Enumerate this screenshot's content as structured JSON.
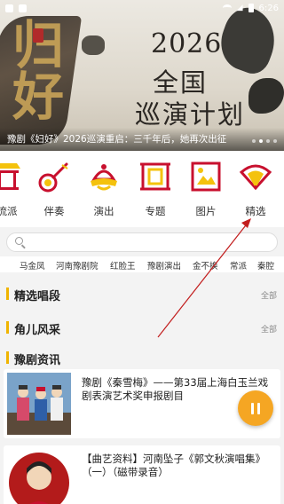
{
  "status_bar": {
    "time": "6:26"
  },
  "banner": {
    "calligraphy": "归好",
    "year": "2026",
    "line1": "全国",
    "line2": "巡演计划",
    "caption": "豫剧《妇好》2026巡演重启：三千年后，她再次出征",
    "dot_count": 4,
    "active_dot": 1
  },
  "categories": [
    {
      "label": "流派",
      "icon": "pavilion-icon"
    },
    {
      "label": "伴奏",
      "icon": "sanxian-instrument-icon"
    },
    {
      "label": "演出",
      "icon": "opera-helmet-icon"
    },
    {
      "label": "专题",
      "icon": "scroll-frame-icon"
    },
    {
      "label": "图片",
      "icon": "picture-frame-icon"
    },
    {
      "label": "精选",
      "icon": "folding-fan-icon"
    }
  ],
  "search": {
    "placeholder": "",
    "value": ""
  },
  "tags": [
    "马金凤",
    "河南豫剧院",
    "红脸王",
    "豫剧演出",
    "金不换",
    "常派",
    "秦腔"
  ],
  "sections": [
    {
      "title": "精选唱段",
      "more": "全部"
    },
    {
      "title": "角儿风采",
      "more": "全部"
    },
    {
      "title": "豫剧资讯",
      "more": ""
    }
  ],
  "news": [
    {
      "title": "豫剧《秦雪梅》——第33届上海白玉兰戏剧表演艺术奖申报剧目"
    },
    {
      "title": "【曲艺资料】河南坠子《郭文秋演唱集》（一）（磁带录音）"
    }
  ],
  "colors": {
    "accent": "#f0b400",
    "icon_red": "#c8102e",
    "icon_yellow": "#f4c20d",
    "fab": "#f5a623",
    "arrow": "#c21d1d"
  }
}
